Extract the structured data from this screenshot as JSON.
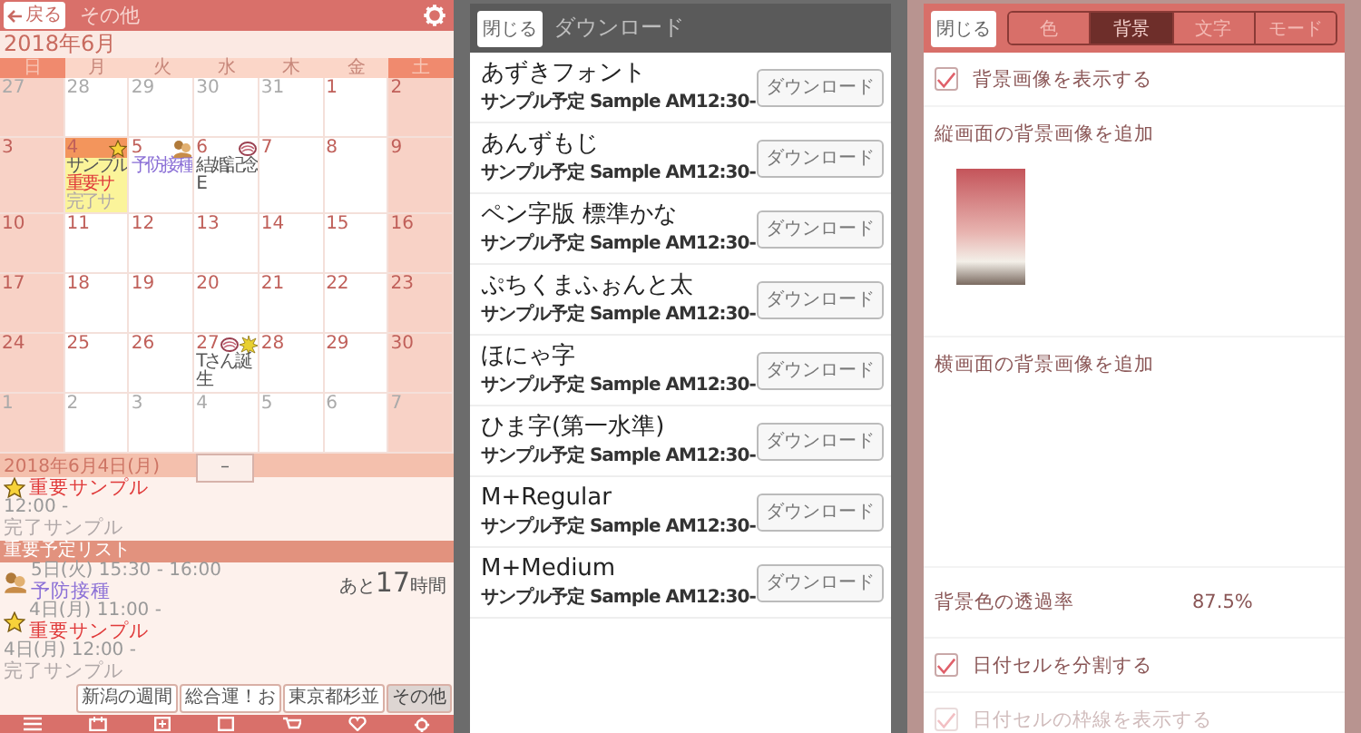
{
  "calendar_screen": {
    "back_button": "戻る",
    "title": "その他",
    "month": "2018年6月",
    "weekdays": [
      "日",
      "月",
      "火",
      "水",
      "木",
      "金",
      "土"
    ],
    "weeks": [
      [
        {
          "day": "27",
          "muted": true,
          "selected": false
        },
        {
          "day": "28",
          "muted": true,
          "selected": false
        },
        {
          "day": "29",
          "muted": true,
          "selected": false
        },
        {
          "day": "30",
          "muted": true,
          "selected": false
        },
        {
          "day": "31",
          "muted": true,
          "selected": false
        },
        {
          "day": "1",
          "muted": false,
          "selected": false
        },
        {
          "day": "2",
          "muted": false,
          "selected": false
        }
      ],
      [
        {
          "day": "3",
          "muted": false,
          "selected": false
        },
        {
          "day": "4",
          "muted": false,
          "selected": true,
          "events": [
            {
              "text": "サンプル",
              "kind": "normal"
            },
            {
              "text": "重要サ",
              "kind": "important"
            },
            {
              "text": "完了サ",
              "kind": "done"
            }
          ],
          "stickers": [
            {
              "kind": "star"
            }
          ]
        },
        {
          "day": "5",
          "muted": false,
          "selected": false,
          "events": [
            {
              "text": "予防接種",
              "kind": "vaccine"
            }
          ],
          "stickers": [
            {
              "kind": "family"
            }
          ]
        },
        {
          "day": "6",
          "muted": false,
          "selected": false,
          "events": [
            {
              "text": "結婚記念E",
              "kind": "normal"
            }
          ],
          "stickers": [
            {
              "kind": "scribble"
            }
          ]
        },
        {
          "day": "7",
          "muted": false,
          "selected": false
        },
        {
          "day": "8",
          "muted": false,
          "selected": false
        },
        {
          "day": "9",
          "muted": false,
          "selected": false
        }
      ],
      [
        {
          "day": "10",
          "muted": false,
          "selected": false
        },
        {
          "day": "11",
          "muted": false,
          "selected": false
        },
        {
          "day": "12",
          "muted": false,
          "selected": false
        },
        {
          "day": "13",
          "muted": false,
          "selected": false
        },
        {
          "day": "14",
          "muted": false,
          "selected": false
        },
        {
          "day": "15",
          "muted": false,
          "selected": false
        },
        {
          "day": "16",
          "muted": false,
          "selected": false
        }
      ],
      [
        {
          "day": "17",
          "muted": false,
          "selected": false
        },
        {
          "day": "18",
          "muted": false,
          "selected": false
        },
        {
          "day": "19",
          "muted": false,
          "selected": false
        },
        {
          "day": "20",
          "muted": false,
          "selected": false
        },
        {
          "day": "21",
          "muted": false,
          "selected": false
        },
        {
          "day": "22",
          "muted": false,
          "selected": false
        },
        {
          "day": "23",
          "muted": false,
          "selected": false
        }
      ],
      [
        {
          "day": "24",
          "muted": false,
          "selected": false
        },
        {
          "day": "25",
          "muted": false,
          "selected": false
        },
        {
          "day": "26",
          "muted": false,
          "selected": false
        },
        {
          "day": "27",
          "muted": false,
          "selected": false,
          "events": [
            {
              "text": "Tさん誕生",
              "kind": "normal"
            }
          ],
          "stickers": [
            {
              "kind": "scribble"
            },
            {
              "kind": "burst"
            }
          ]
        },
        {
          "day": "28",
          "muted": false,
          "selected": false
        },
        {
          "day": "29",
          "muted": false,
          "selected": false
        },
        {
          "day": "30",
          "muted": false,
          "selected": false
        }
      ],
      [
        {
          "day": "1",
          "muted": true,
          "selected": false
        },
        {
          "day": "2",
          "muted": true,
          "selected": false
        },
        {
          "day": "3",
          "muted": true,
          "selected": false
        },
        {
          "day": "4",
          "muted": true,
          "selected": false
        },
        {
          "day": "5",
          "muted": true,
          "selected": false
        },
        {
          "day": "6",
          "muted": true,
          "selected": false
        },
        {
          "day": "7",
          "muted": true,
          "selected": false
        }
      ]
    ],
    "selected_date": "2018年6月4日(月)",
    "collapse_button": "–",
    "day_events": [
      {
        "title": "重要サンプル",
        "kind": "important",
        "stickers": [
          {
            "kind": "star"
          }
        ]
      },
      {
        "time": "12:00 -",
        "title": "完了サンプル",
        "kind": "done"
      }
    ],
    "important_list": {
      "title": "重要予定リスト",
      "items": [
        {
          "time": "5日(火) 15:30 - 16:00",
          "title": "予防接種",
          "kind": "vaccine",
          "stickers": [
            {
              "kind": "family"
            }
          ],
          "countdown": "あと**17**時間"
        },
        {
          "time": "4日(月) 11:00 -",
          "title": "重要サンプル",
          "kind": "important",
          "stickers": [
            {
              "kind": "star"
            }
          ]
        },
        {
          "time": "4日(月) 12:00 -",
          "title": "完了サンプル",
          "kind": "done"
        }
      ]
    },
    "shortcuts": [
      {
        "label": "新潟の週間",
        "selected": false
      },
      {
        "label": "総合運！お",
        "selected": false
      },
      {
        "label": "東京都杉並",
        "selected": false
      },
      {
        "label": "その他",
        "selected": true
      }
    ]
  },
  "download_screen": {
    "close_button": "閉じる",
    "title": "ダウンロード",
    "fonts": [
      {
        "name": "あずきフォント",
        "sample": "サンプル予定 Sample AM12:30-",
        "button": "ダウンロード"
      },
      {
        "name": "あんずもじ",
        "sample": "サンプル予定 Sample AM12:30-",
        "button": "ダウンロード"
      },
      {
        "name": "ペン字版 標準かな",
        "sample": "サンプル予定 Sample AM12:30-",
        "button": "ダウンロード"
      },
      {
        "name": "ぷちくまふぉんと太",
        "sample": "サンプル予定 Sample AM12:30-",
        "button": "ダウンロード"
      },
      {
        "name": "ほにゃ字",
        "sample": "サンプル予定 Sample AM12:30-",
        "button": "ダウンロード"
      },
      {
        "name": "ひま字(第一水準)",
        "sample": "サンプル予定 Sample AM12:30-",
        "button": "ダウンロード"
      },
      {
        "name": "M+Regular",
        "sample": "サンプル予定 Sample AM12:30-",
        "button": "ダウンロード"
      },
      {
        "name": "M+Medium",
        "sample": "サンプル予定 Sample AM12:30-",
        "button": "ダウンロード"
      }
    ]
  },
  "settings_screen": {
    "close_button": "閉じる",
    "tabs": [
      {
        "label": "色",
        "selected": false
      },
      {
        "label": "背景",
        "selected": true
      },
      {
        "label": "文字",
        "selected": false
      },
      {
        "label": "モード",
        "selected": false
      }
    ],
    "items": [
      {
        "kind": "checkbox",
        "label": "背景画像を表示する",
        "checked": true,
        "disabled": false
      },
      {
        "kind": "image_slot",
        "label": "縦画面の背景画像を追加",
        "has_image": true
      },
      {
        "kind": "image_slot",
        "label": "横画面の背景画像を追加",
        "has_image": false
      },
      {
        "kind": "value",
        "label": "背景色の透過率",
        "value": "87.5%"
      },
      {
        "kind": "checkbox",
        "label": "日付セルを分割する",
        "checked": true,
        "disabled": false
      },
      {
        "kind": "checkbox",
        "label": "日付セルの枠線を表示する",
        "checked": true,
        "disabled": true
      }
    ]
  }
}
